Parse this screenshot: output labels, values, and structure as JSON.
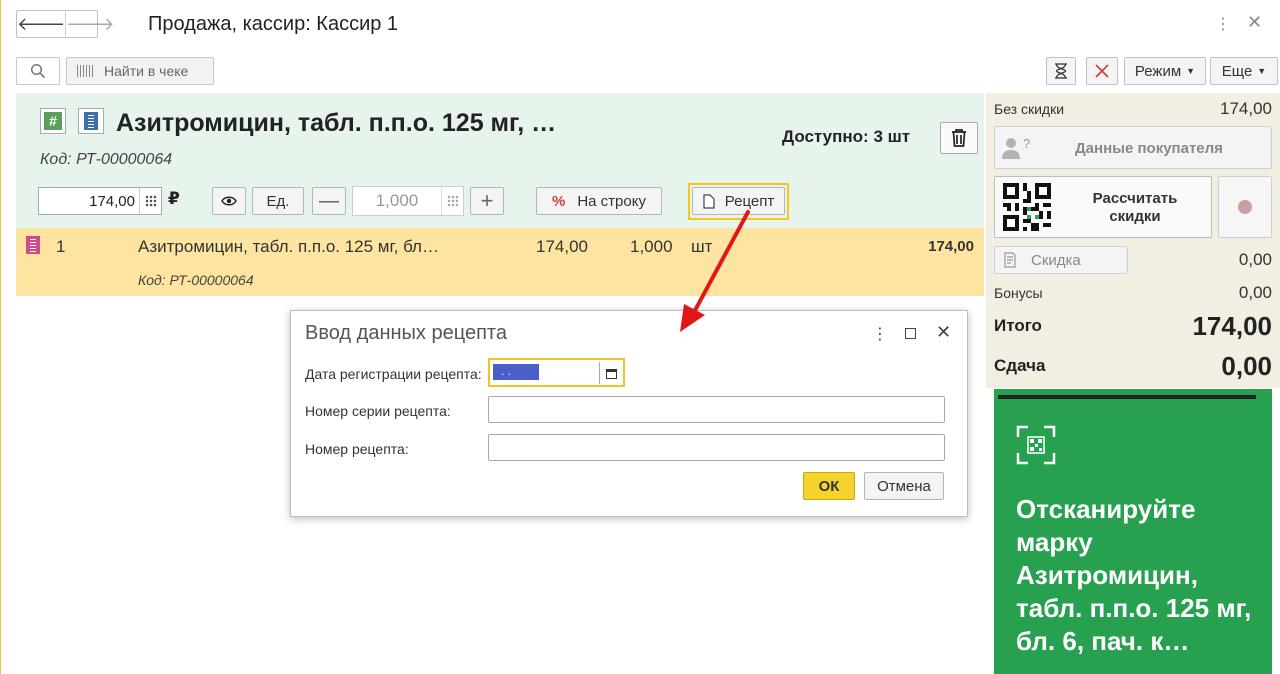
{
  "window": {
    "title": "Продажа, кассир: Кассир 1"
  },
  "toolbar": {
    "find_in_receipt": "Найти в чеке",
    "mode": "Режим",
    "more": "Еще"
  },
  "product": {
    "title": "Азитромицин, табл. п.п.о. 125 мг, …",
    "code": "Код: РТ-00000064",
    "available": "Доступно: 3 шт",
    "price": "174,00",
    "currency": "₽",
    "unit_button": "Ед.",
    "quantity": "1,000",
    "discount_button": "На строку",
    "discount_symbol": "%",
    "recipe_button": "Рецепт"
  },
  "line": {
    "number": "1",
    "name": "Азитромицин, табл. п.п.о. 125 мг, бл…",
    "price": "174,00",
    "quantity": "1,000",
    "unit": "шт",
    "sum": "174,00",
    "code": "Код: РТ-00000064"
  },
  "side": {
    "no_discount_label": "Без скидки",
    "no_discount_value": "174,00",
    "customer_data": "Данные покупателя",
    "calc_discounts_line1": "Рассчитать",
    "calc_discounts_line2": "скидки",
    "discount_label": "Скидка",
    "discount_value": "0,00",
    "bonus_label": "Бонусы",
    "bonus_value": "0,00",
    "total_label": "Итого",
    "total_value": "174,00",
    "change_label": "Сдача",
    "change_value": "0,00",
    "scan_message": "Отсканируйте марку Азитромицин, табл. п.п.о. 125 мг, бл. 6, пач. к…"
  },
  "dialog": {
    "title": "Ввод данных рецепта",
    "date_label": "Дата регистрации рецепта:",
    "date_value": " .  .",
    "series_label": "Номер серии рецепта:",
    "number_label": "Номер рецепта:",
    "ok": "ОК",
    "cancel": "Отмена"
  },
  "colors": {
    "accent_yellow": "#f6d22c",
    "panel_green": "#e6f4ec",
    "scan_green": "#27a050",
    "arrow_red": "#e01818"
  }
}
